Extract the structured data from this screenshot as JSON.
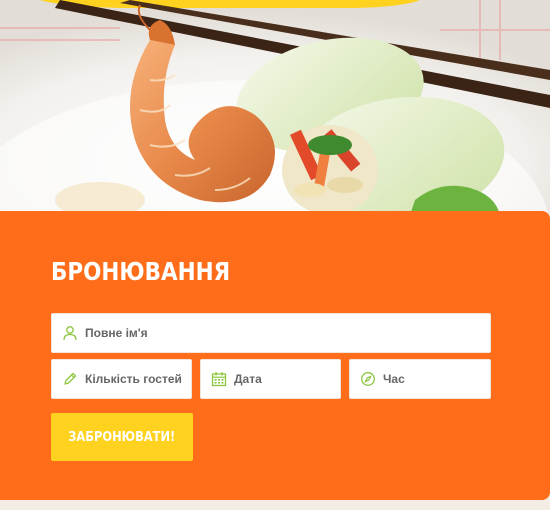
{
  "hero": {
    "image": "shrimp-spring-rolls-photo"
  },
  "booking": {
    "title": "БРОНЮВАННЯ",
    "fields": {
      "name": {
        "placeholder": "Повне ім'я",
        "value": "",
        "icon": "user-icon"
      },
      "guests": {
        "placeholder": "Кількість гостей",
        "value": "",
        "icon": "pencil-icon"
      },
      "date": {
        "placeholder": "Дата",
        "value": "",
        "icon": "calendar-icon"
      },
      "time": {
        "placeholder": "Час",
        "value": "",
        "icon": "compass-icon"
      }
    },
    "submit_label": "ЗАБРОНЮВАТИ!"
  },
  "colors": {
    "card": "#ff6d1a",
    "button": "#ffd21f",
    "icon": "#8cc63f",
    "accent_top": "#ffd21f"
  }
}
